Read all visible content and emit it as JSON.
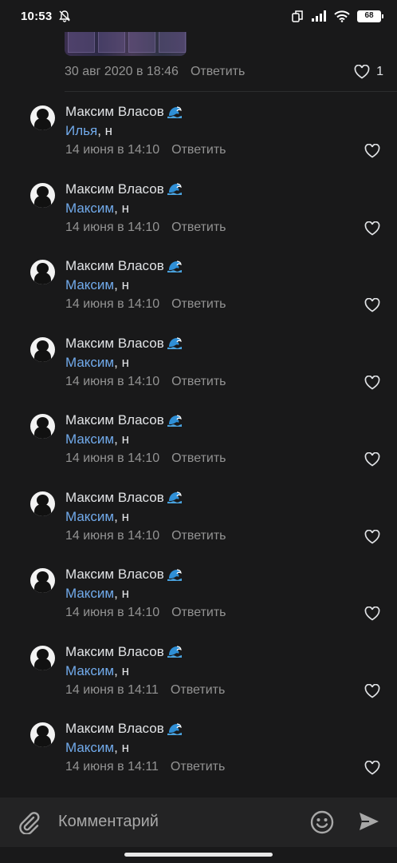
{
  "status_bar": {
    "time": "10:53",
    "battery": "68",
    "icons": [
      "bell-off-icon",
      "sim-icon",
      "signal-icon",
      "wifi-icon",
      "battery-icon"
    ]
  },
  "previous_comment": {
    "date": "30 авг 2020 в 18:46",
    "reply_label": "Ответить",
    "like_count": "1"
  },
  "comments": [
    {
      "author": "Максим Власов",
      "mention": "Илья",
      "text": ", н",
      "date": "14 июня в 14:10",
      "reply_label": "Ответить"
    },
    {
      "author": "Максим Власов",
      "mention": "Максим",
      "text": ", н",
      "date": "14 июня в 14:10",
      "reply_label": "Ответить"
    },
    {
      "author": "Максим Власов",
      "mention": "Максим",
      "text": ", н",
      "date": "14 июня в 14:10",
      "reply_label": "Ответить"
    },
    {
      "author": "Максим Власов",
      "mention": "Максим",
      "text": ", н",
      "date": "14 июня в 14:10",
      "reply_label": "Ответить"
    },
    {
      "author": "Максим Власов",
      "mention": "Максим",
      "text": ", н",
      "date": "14 июня в 14:10",
      "reply_label": "Ответить"
    },
    {
      "author": "Максим Власов",
      "mention": "Максим",
      "text": ", н",
      "date": "14 июня в 14:10",
      "reply_label": "Ответить"
    },
    {
      "author": "Максим Власов",
      "mention": "Максим",
      "text": ", н",
      "date": "14 июня в 14:10",
      "reply_label": "Ответить"
    },
    {
      "author": "Максим Власов",
      "mention": "Максим",
      "text": ", н",
      "date": "14 июня в 14:11",
      "reply_label": "Ответить"
    },
    {
      "author": "Максим Власов",
      "mention": "Максим",
      "text": ", н",
      "date": "14 июня в 14:11",
      "reply_label": "Ответить"
    }
  ],
  "composer": {
    "placeholder": "Комментарий",
    "icons": [
      "attach-icon",
      "emoji-icon",
      "send-icon"
    ]
  },
  "colors": {
    "background": "#19191a",
    "mention": "#71aaeb",
    "secondary_text": "#939393",
    "composer_bg": "#232324"
  }
}
